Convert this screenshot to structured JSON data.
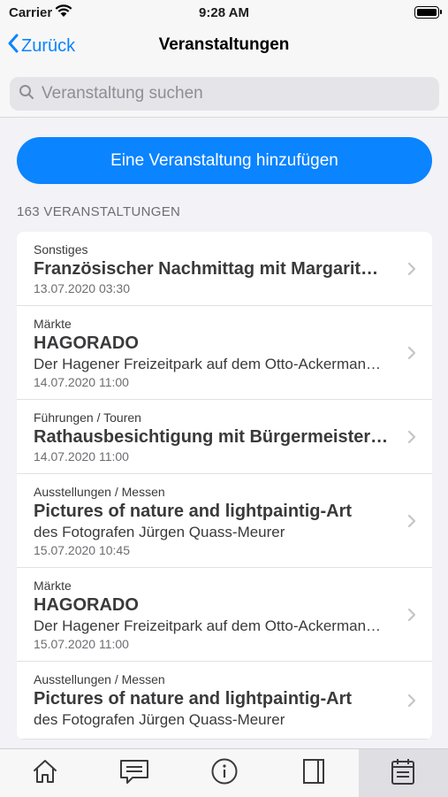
{
  "status": {
    "carrier": "Carrier",
    "time": "9:28 AM"
  },
  "nav": {
    "back_label": "Zurück",
    "title": "Veranstaltungen"
  },
  "search": {
    "placeholder": "Veranstaltung suchen"
  },
  "add_button_label": "Eine Veranstaltung hinzufügen",
  "count_label": "163 VERANSTALTUNGEN",
  "events": [
    {
      "category": "Sonstiges",
      "title": "Französischer Nachmittag mit Margarit…",
      "subtitle": "",
      "date": "13.07.2020 03:30"
    },
    {
      "category": "Märkte",
      "title": "HAGORADO",
      "subtitle": "Der Hagener Freizeitpark auf dem Otto-Ackerman…",
      "date": "14.07.2020 11:00"
    },
    {
      "category": "Führungen / Touren",
      "title": "Rathausbesichtigung mit Bürgermeister…",
      "subtitle": "",
      "date": "14.07.2020 11:00"
    },
    {
      "category": "Ausstellungen / Messen",
      "title": "Pictures of nature and lightpaintig-Art",
      "subtitle": "des Fotografen Jürgen Quass-Meurer",
      "date": "15.07.2020 10:45"
    },
    {
      "category": "Märkte",
      "title": "HAGORADO",
      "subtitle": "Der Hagener Freizeitpark auf dem Otto-Ackerman…",
      "date": "15.07.2020 11:00"
    },
    {
      "category": "Ausstellungen / Messen",
      "title": "Pictures of nature and lightpaintig-Art",
      "subtitle": "des Fotografen Jürgen Quass-Meurer",
      "date": ""
    }
  ],
  "tabs": [
    {
      "icon": "home-icon",
      "active": false
    },
    {
      "icon": "message-icon",
      "active": false
    },
    {
      "icon": "info-icon",
      "active": false
    },
    {
      "icon": "book-icon",
      "active": false
    },
    {
      "icon": "calendar-icon",
      "active": true
    }
  ],
  "colors": {
    "accent": "#0a84ff",
    "background": "#f2f2f7"
  }
}
